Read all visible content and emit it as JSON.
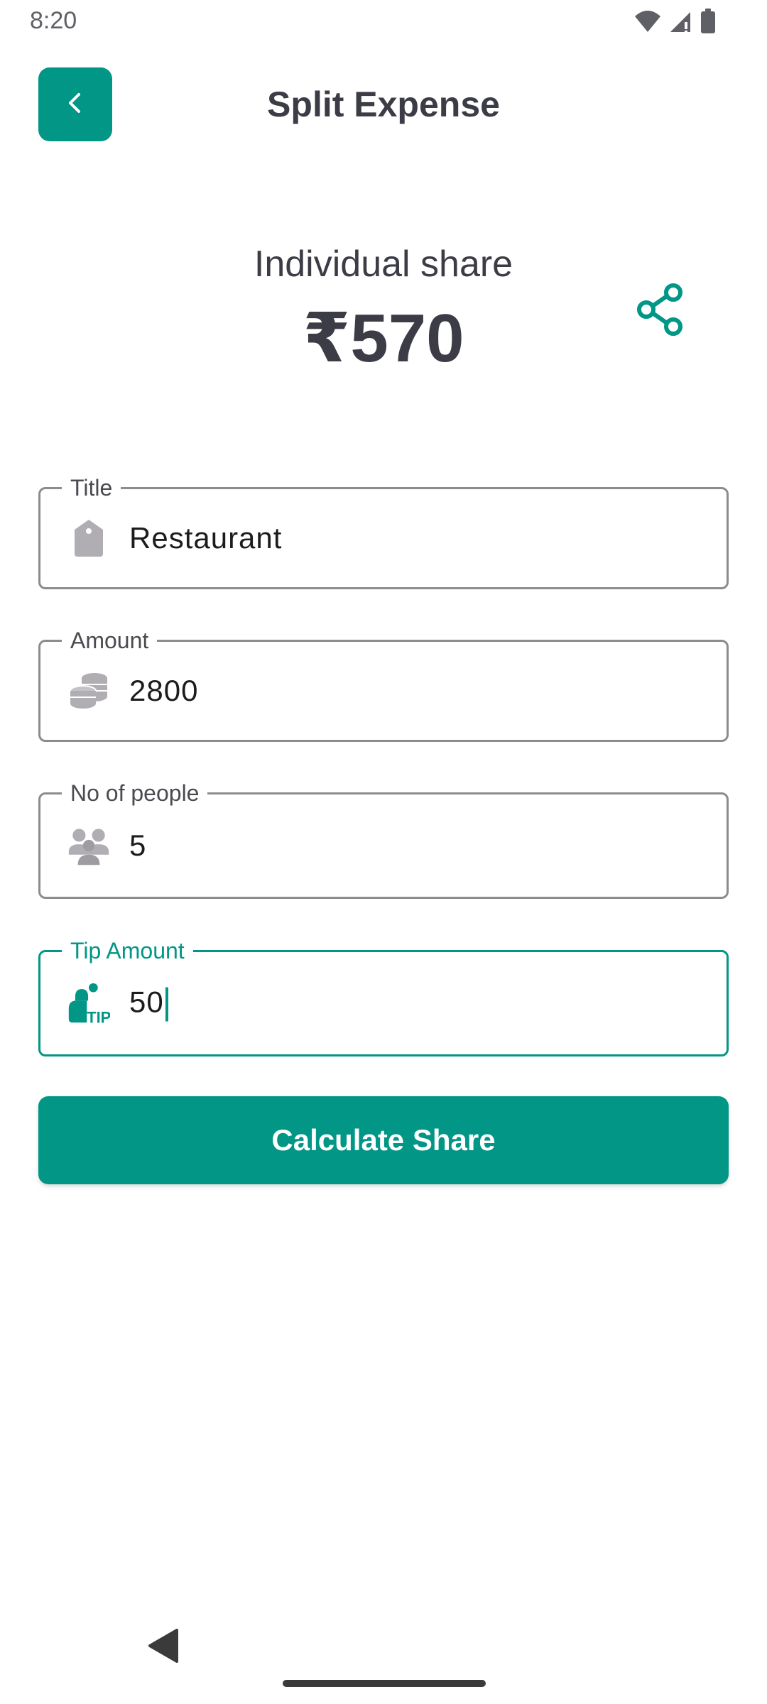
{
  "status_bar": {
    "time": "8:20",
    "icons": [
      "wifi-icon",
      "cell-signal-icon",
      "battery-icon"
    ]
  },
  "header": {
    "back_icon": "chevron-left-icon",
    "title": "Split Expense"
  },
  "summary": {
    "label": "Individual share",
    "value": "₹570",
    "share_icon": "share-icon"
  },
  "form": {
    "title_field": {
      "label": "Title",
      "value": "Restaurant",
      "icon": "tag-icon"
    },
    "amount_field": {
      "label": "Amount",
      "value": "2800",
      "icon": "coins-icon"
    },
    "people_field": {
      "label": "No of people",
      "value": "5",
      "icon": "people-icon"
    },
    "tip_field": {
      "label": "Tip Amount",
      "value": "50",
      "icon": "tip-icon",
      "focused": true
    }
  },
  "actions": {
    "calculate_label": "Calculate Share"
  },
  "nav_bar": {
    "back_icon": "nav-back-icon",
    "home_indicator": "home-indicator"
  },
  "colors": {
    "accent": "#019686",
    "text_primary": "#3c3c46",
    "field_border": "#8c8c8c",
    "icon_grey": "#b0aeb3"
  }
}
